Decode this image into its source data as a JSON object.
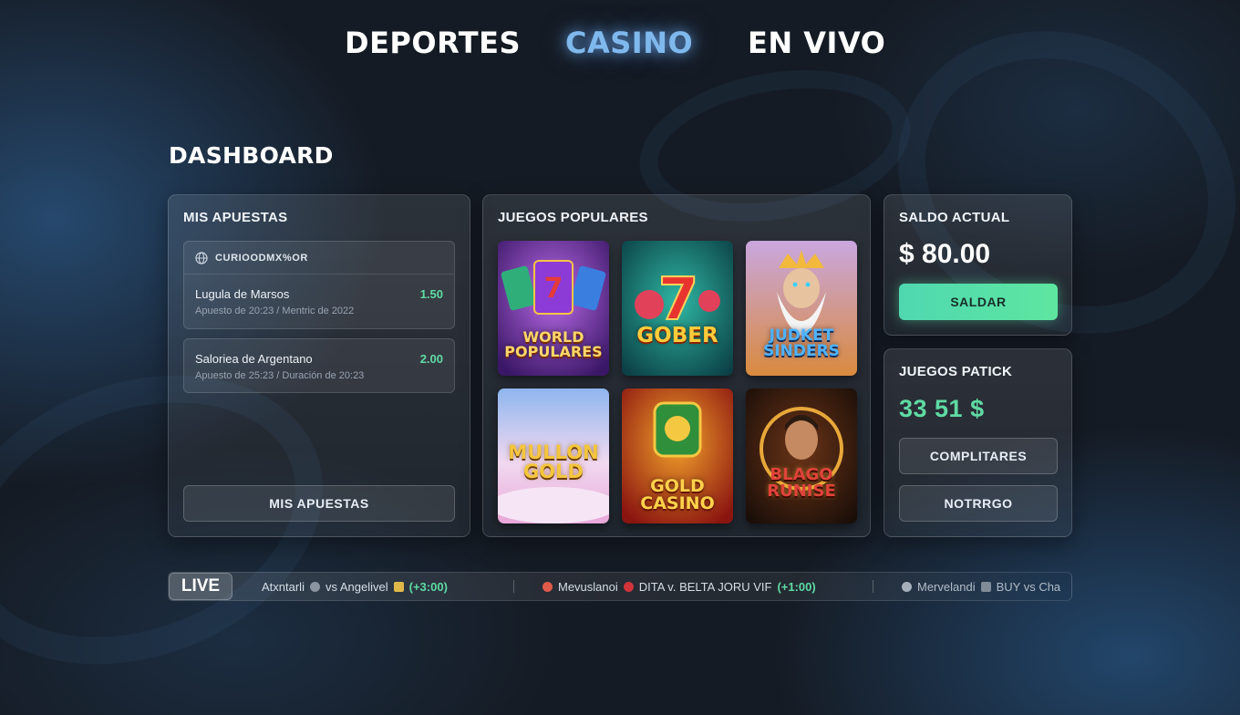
{
  "nav": {
    "items": [
      {
        "label": "DEPORTES",
        "active": false
      },
      {
        "label": "CASINO",
        "active": true
      },
      {
        "label": "EN VIVO",
        "active": false
      }
    ]
  },
  "page": {
    "title": "DASHBOARD"
  },
  "bets_panel": {
    "title": "MIS APUESTAS",
    "card_header": "CURIOODMX%OR",
    "bets": [
      {
        "name": "Lugula de Marsos",
        "sub": "Apuesto de 20:23  /  Mentric de 2022",
        "odds": "1.50"
      },
      {
        "name": "Saloriea de Argentano",
        "sub": "Apuesto de 25:23  /  Duración de 20:23",
        "odds": "2.00"
      }
    ],
    "button_label": "MIS APUESTAS"
  },
  "games_panel": {
    "title": "JUEGOS POPULARES",
    "games": [
      {
        "name": "WORLD\nPOPULARES",
        "theme": "purple"
      },
      {
        "name": "GOBER",
        "theme": "teal"
      },
      {
        "name": "JUDKET\nSINDERS",
        "theme": "zeus"
      },
      {
        "name": "MULLON\nGOLD",
        "theme": "pastel"
      },
      {
        "name": "GOLD\nCASINO",
        "theme": "red"
      },
      {
        "name": "BLAGO\nRUNISE",
        "theme": "dark"
      }
    ]
  },
  "balance_panel": {
    "title": "SALDO ACTUAL",
    "amount": "$ 80.00",
    "button_label": "SALDAR"
  },
  "jackpot_panel": {
    "title": "JUEGOS PATICK",
    "amount": "33 51 $",
    "buttons": [
      "COMPLITARES",
      "NOTRRGO"
    ]
  },
  "live": {
    "badge": "LIVE",
    "items": [
      {
        "team_a": "Atxntarli",
        "team_b": "vs Angelivel",
        "score": "(+3:00)"
      },
      {
        "team_a": "Mevuslanoi",
        "team_b": "DITA v. BELTA JORU VIF",
        "score": "(+1:00)"
      },
      {
        "team_a": "Mervelandi",
        "team_b": "BUY vs Cha",
        "score": ""
      }
    ]
  },
  "colors": {
    "accent_green": "#5fdba3",
    "nav_active": "#7fb8ec",
    "background": "#151b24"
  }
}
